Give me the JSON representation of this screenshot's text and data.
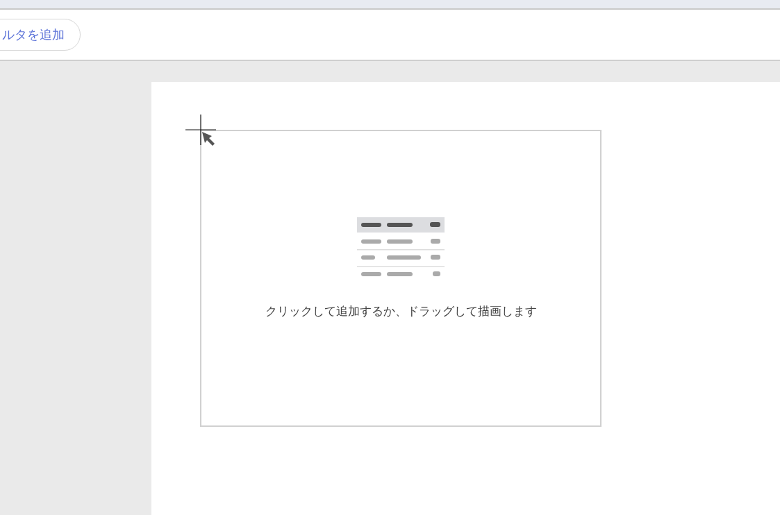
{
  "toolbar": {
    "filter_button": "ルタを追加"
  },
  "canvas": {
    "placeholder": {
      "hint": "クリックして追加するか、ドラッグして描画します"
    }
  }
}
